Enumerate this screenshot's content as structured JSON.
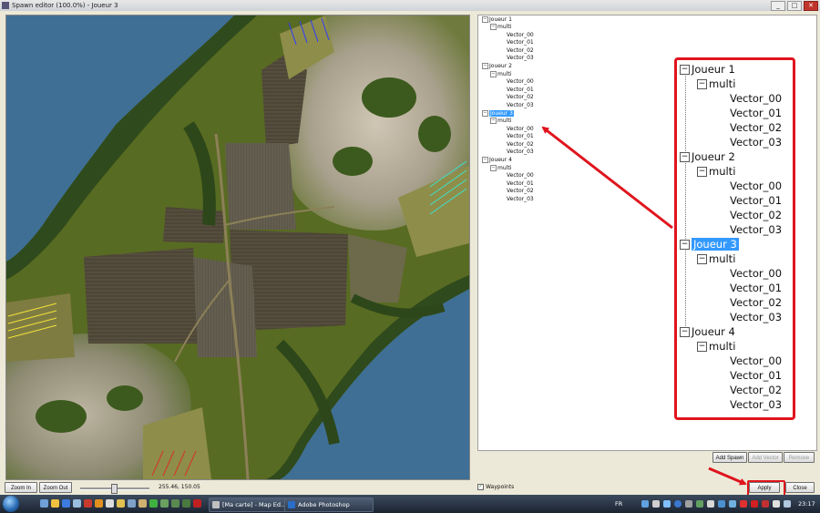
{
  "window": {
    "title": "Spawn editor (100.0%) - Joueur 3",
    "minimize": "_",
    "maximize": "□",
    "close": "✕"
  },
  "tree": {
    "players": [
      {
        "name": "Joueur 1",
        "group": "multi",
        "vectors": [
          "Vector_00",
          "Vector_01",
          "Vector_02",
          "Vector_03"
        ]
      },
      {
        "name": "Joueur 2",
        "group": "multi",
        "vectors": [
          "Vector_00",
          "Vector_01",
          "Vector_02",
          "Vector_03"
        ]
      },
      {
        "name": "Joueur 3",
        "group": "multi",
        "vectors": [
          "Vector_00",
          "Vector_01",
          "Vector_02",
          "Vector_03"
        ]
      },
      {
        "name": "Joueur 4",
        "group": "multi",
        "vectors": [
          "Vector_00",
          "Vector_01",
          "Vector_02",
          "Vector_03"
        ]
      }
    ],
    "selected": "Joueur 3",
    "expander": "−"
  },
  "buttons": {
    "add_spawn": "Add Spawn",
    "add_vector": "Add Vector",
    "remove": "Remove",
    "apply": "Apply",
    "close": "Close",
    "zoom_in": "Zoom In",
    "zoom_out": "Zoom Out"
  },
  "status": {
    "coords": "255.46, 150.05",
    "waypoints_label": "Waypoints",
    "waypoints_checked": true,
    "check_glyph": "✓"
  },
  "taskbar": {
    "tasks": [
      "[Ma carte] - Map Ed...",
      "Adobe Photoshop"
    ],
    "language": "FR",
    "clock": "23:17"
  },
  "colors": {
    "annotation_red": "#e0141e",
    "selection_blue": "#3399ff",
    "arrow_yellow": "#f2e23a",
    "arrow_cyan": "#3fe0c8",
    "arrow_blue": "#2a3cff",
    "arrow_red": "#d8321c"
  }
}
